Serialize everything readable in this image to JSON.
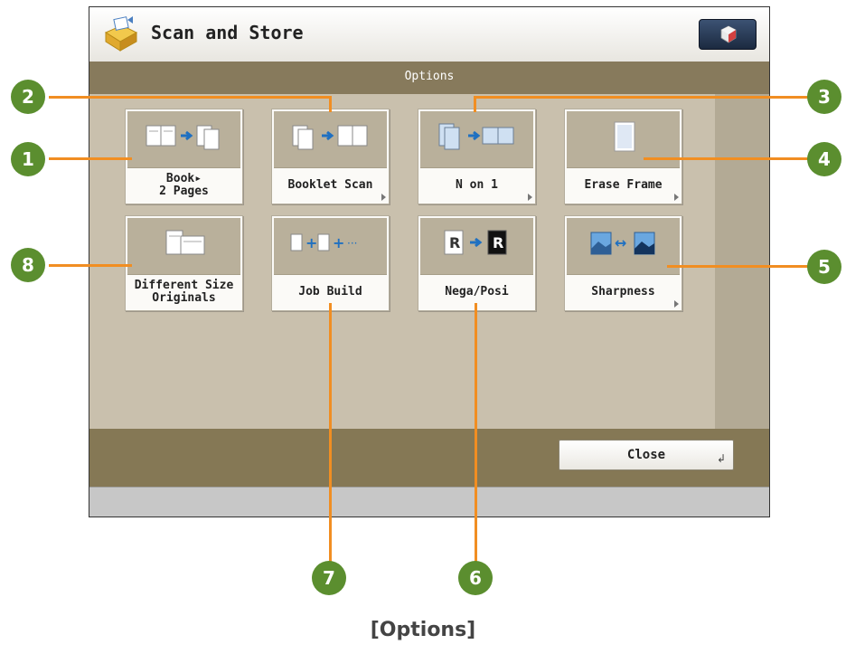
{
  "window": {
    "title": "Scan and Store",
    "top_icon": "gear-cube-icon"
  },
  "options_header": "Options",
  "options": [
    {
      "id": "book-2-pages",
      "label": "Book▸\n2 Pages",
      "icon": "book-pages-icon"
    },
    {
      "id": "booklet-scan",
      "label": "Booklet Scan",
      "icon": "booklet-scan-icon"
    },
    {
      "id": "n-on-1",
      "label": "N on 1",
      "icon": "n-on-1-icon"
    },
    {
      "id": "erase-frame",
      "label": "Erase Frame",
      "icon": "erase-frame-icon"
    },
    {
      "id": "different-size-originals",
      "label": "Different Size\nOriginals",
      "icon": "different-size-originals-icon"
    },
    {
      "id": "job-build",
      "label": "Job Build",
      "icon": "job-build-icon"
    },
    {
      "id": "nega-posi",
      "label": "Nega/Posi",
      "icon": "nega-posi-icon"
    },
    {
      "id": "sharpness",
      "label": "Sharpness",
      "icon": "sharpness-icon"
    }
  ],
  "close_label": "Close",
  "callouts": [
    "1",
    "2",
    "3",
    "4",
    "5",
    "6",
    "7",
    "8"
  ],
  "caption": "[Options]",
  "colors": {
    "callout_fill": "#5b8e2f",
    "callout_line": "#f18e22",
    "accent_bar": "#877a5c"
  }
}
